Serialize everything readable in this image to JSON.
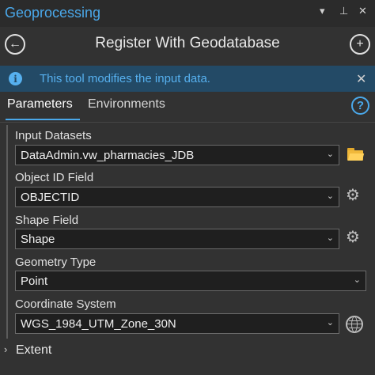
{
  "window": {
    "title": "Geoprocessing",
    "controls": {
      "menu": "▾",
      "pin": "⊥",
      "close": "✕"
    }
  },
  "nav": {
    "back_icon": "arrow-left-circle",
    "tool_title": "Register With Geodatabase",
    "add_icon": "plus-circle"
  },
  "info_bar": {
    "icon": "info",
    "message": "This tool modifies the input data.",
    "close": "✕"
  },
  "tabs": [
    {
      "label": "Parameters",
      "active": true
    },
    {
      "label": "Environments",
      "active": false
    }
  ],
  "help_icon": "?",
  "parameters": [
    {
      "label": "Input Datasets",
      "value": "DataAdmin.vw_pharmacies_JDB",
      "side_icon": "folder-open"
    },
    {
      "label": "Object ID Field",
      "value": "OBJECTID",
      "side_icon": "gear"
    },
    {
      "label": "Shape Field",
      "value": "Shape",
      "side_icon": "gear"
    },
    {
      "label": "Geometry Type",
      "value": "Point"
    },
    {
      "label": "Coordinate System",
      "value": "WGS_1984_UTM_Zone_30N",
      "side_icon": "globe"
    }
  ],
  "extent": {
    "label": "Extent",
    "expanded": false
  },
  "colors": {
    "accent": "#4aa8ea",
    "info_bg": "#234a66",
    "info_text": "#56b0ef",
    "panel_bg": "#323232",
    "field_bg": "#1f1f1f"
  }
}
